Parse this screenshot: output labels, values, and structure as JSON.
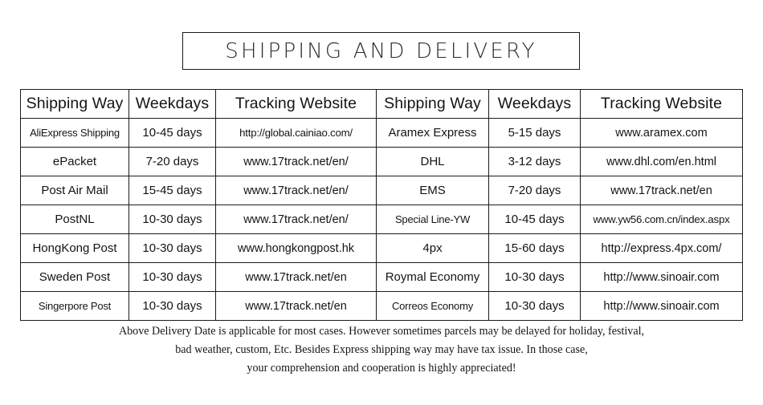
{
  "title": "SHIPPING  AND  DELIVERY",
  "table": {
    "headers_left": [
      "Shipping Way",
      "Weekdays",
      "Tracking Website"
    ],
    "headers_right": [
      "Shipping Way",
      "Weekdays",
      "Tracking Website"
    ],
    "rows": [
      {
        "left": {
          "way": "AliExpress Shipping",
          "weekdays": "10-45 days",
          "site": "http://global.cainiao.com/"
        },
        "right": {
          "way": "Aramex Express",
          "weekdays": "5-15 days",
          "site": "www.aramex.com"
        }
      },
      {
        "left": {
          "way": "ePacket",
          "weekdays": "7-20 days",
          "site": "www.17track.net/en/"
        },
        "right": {
          "way": "DHL",
          "weekdays": "3-12 days",
          "site": "www.dhl.com/en.html"
        }
      },
      {
        "left": {
          "way": "Post Air Mail",
          "weekdays": "15-45 days",
          "site": "www.17track.net/en/"
        },
        "right": {
          "way": "EMS",
          "weekdays": "7-20 days",
          "site": "www.17track.net/en"
        }
      },
      {
        "left": {
          "way": "PostNL",
          "weekdays": "10-30 days",
          "site": "www.17track.net/en/"
        },
        "right": {
          "way": "Special Line-YW",
          "weekdays": "10-45 days",
          "site": "www.yw56.com.cn/index.aspx"
        }
      },
      {
        "left": {
          "way": "HongKong Post",
          "weekdays": "10-30 days",
          "site": "www.hongkongpost.hk"
        },
        "right": {
          "way": "4px",
          "weekdays": "15-60 days",
          "site": "http://express.4px.com/"
        }
      },
      {
        "left": {
          "way": "Sweden Post",
          "weekdays": "10-30 days",
          "site": "www.17track.net/en"
        },
        "right": {
          "way": "Roymal Economy",
          "weekdays": "10-30 days",
          "site": "http://www.sinoair.com"
        }
      },
      {
        "left": {
          "way": "Singerpore Post",
          "weekdays": "10-30 days",
          "site": "www.17track.net/en"
        },
        "right": {
          "way": "Correos Economy",
          "weekdays": "10-30 days",
          "site": "http://www.sinoair.com"
        }
      }
    ]
  },
  "footer": {
    "line1": "Above Delivery Date is applicable for most cases. However sometimes parcels may be delayed for holiday, festival,",
    "line2": "bad weather, custom, Etc. Besides Express shipping way may have tax issue. In those case,",
    "line3": "your comprehension and cooperation is highly appreciated!"
  },
  "colors": {
    "border": "#1c1c1c",
    "text": "#141414",
    "background": "#ffffff"
  }
}
